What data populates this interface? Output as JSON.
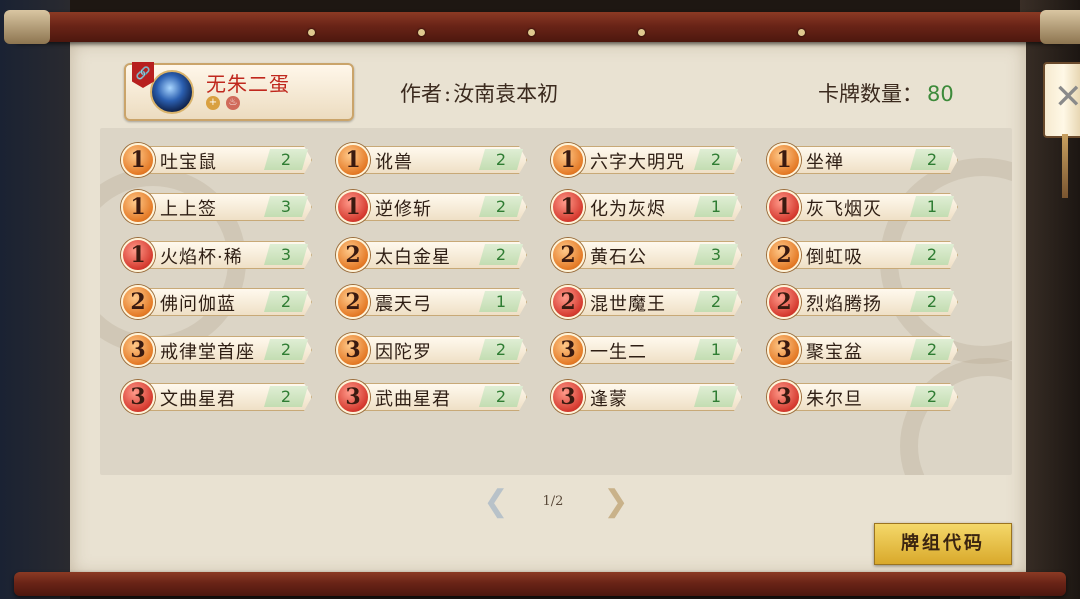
{
  "header": {
    "player_name": "无朱二蛋",
    "player_badge": "🔗",
    "author_label": "作者",
    "author_sep": ":",
    "author_name": "汝南袁本初",
    "count_label": "卡牌数量：",
    "count_value": "80"
  },
  "cards": [
    {
      "cost": "1",
      "color": "orange",
      "name": "吐宝鼠",
      "qty": "2"
    },
    {
      "cost": "1",
      "color": "orange",
      "name": "讹兽",
      "qty": "2"
    },
    {
      "cost": "1",
      "color": "orange",
      "name": "六字大明咒",
      "qty": "2"
    },
    {
      "cost": "1",
      "color": "orange",
      "name": "坐禅",
      "qty": "2"
    },
    {
      "cost": "1",
      "color": "orange",
      "name": "上上签",
      "qty": "3"
    },
    {
      "cost": "1",
      "color": "red",
      "name": "逆修斩",
      "qty": "2"
    },
    {
      "cost": "1",
      "color": "red",
      "name": "化为灰烬",
      "qty": "1"
    },
    {
      "cost": "1",
      "color": "red",
      "name": "灰飞烟灭",
      "qty": "1"
    },
    {
      "cost": "1",
      "color": "red",
      "name": "火焰杯·稀",
      "qty": "3"
    },
    {
      "cost": "2",
      "color": "orange",
      "name": "太白金星",
      "qty": "2"
    },
    {
      "cost": "2",
      "color": "orange",
      "name": "黄石公",
      "qty": "3"
    },
    {
      "cost": "2",
      "color": "orange",
      "name": "倒虹吸",
      "qty": "2"
    },
    {
      "cost": "2",
      "color": "orange",
      "name": "佛问伽蓝",
      "qty": "2"
    },
    {
      "cost": "2",
      "color": "orange",
      "name": "震天弓",
      "qty": "1"
    },
    {
      "cost": "2",
      "color": "red",
      "name": "混世魔王",
      "qty": "2"
    },
    {
      "cost": "2",
      "color": "red",
      "name": "烈焰腾扬",
      "qty": "2"
    },
    {
      "cost": "3",
      "color": "orange",
      "name": "戒律堂首座",
      "qty": "2"
    },
    {
      "cost": "3",
      "color": "orange",
      "name": "因陀罗",
      "qty": "2"
    },
    {
      "cost": "3",
      "color": "orange",
      "name": "一生二",
      "qty": "1"
    },
    {
      "cost": "3",
      "color": "orange",
      "name": "聚宝盆",
      "qty": "2"
    },
    {
      "cost": "3",
      "color": "red",
      "name": "文曲星君",
      "qty": "2"
    },
    {
      "cost": "3",
      "color": "red",
      "name": "武曲星君",
      "qty": "2"
    },
    {
      "cost": "3",
      "color": "red",
      "name": "逢蒙",
      "qty": "1"
    },
    {
      "cost": "3",
      "color": "red",
      "name": "朱尔旦",
      "qty": "2"
    }
  ],
  "pager": {
    "page_text": "1/2",
    "prev_icon": "cloud-left-arrow-icon",
    "next_icon": "cloud-right-arrow-icon"
  },
  "deck_code_label": "牌组代码",
  "close_icon": "close-x-icon",
  "colors": {
    "cost_orange": "#e47a26",
    "cost_red": "#d53a2f",
    "qty_green": "#2f7d33",
    "name_red": "#c0281e"
  }
}
